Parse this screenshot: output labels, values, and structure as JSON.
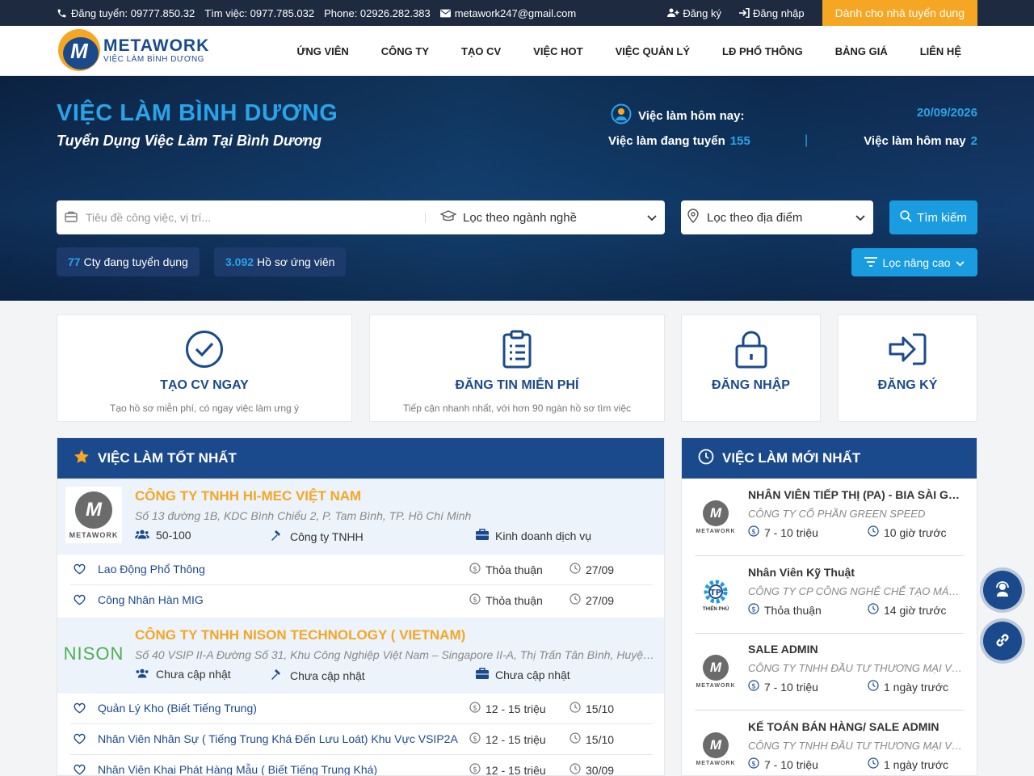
{
  "topbar": {
    "hotline_recruit": "Đăng tuyển: 09777.850.32",
    "hotline_job": "Tìm việc: 0977.785.032",
    "phone": "Phone: 02926.282.383",
    "email": "metawork247@gmail.com",
    "register": "Đăng ký",
    "login": "Đăng nhập",
    "employer": "Dành cho nhà tuyển dụng"
  },
  "logo": {
    "brand": "METAWORK",
    "sub": "VIỆC LÀM BÌNH DƯƠNG",
    "mark": "M"
  },
  "nav": [
    "ỨNG VIÊN",
    "CÔNG TY",
    "TẠO CV",
    "VIỆC HOT",
    "VIỆC QUẢN LÝ",
    "LĐ PHỔ THÔNG",
    "BẢNG GIÁ",
    "LIÊN HỆ"
  ],
  "hero": {
    "title": "VIỆC LÀM BÌNH DƯƠNG",
    "subtitle": "Tuyển Dụng Việc Làm Tại Bình Dương",
    "today_label": "Việc làm hôm nay:",
    "date": "20/09/2026",
    "open_label": "Việc làm đang tuyển",
    "open_count": "155",
    "sep": "|",
    "today_jobs_label": "Việc làm hôm nay",
    "today_jobs_count": "2"
  },
  "search": {
    "placeholder": "Tiêu đề công việc, vị trí...",
    "category": "Lọc theo ngành nghề",
    "location": "Lọc theo địa điểm",
    "button": "Tìm kiếm",
    "companies_count": "77",
    "companies_label": "Cty đang tuyển dụng",
    "cv_count": "3.092",
    "cv_label": "Hồ sơ ứng viên",
    "advanced": "Lọc nâng cao"
  },
  "features": [
    {
      "title": "TẠO CV NGAY",
      "desc": "Tạo hồ sơ miễn phí, có ngay việc làm ưng ý",
      "icon": "check-circle-icon"
    },
    {
      "title": "ĐĂNG TIN MIỄN PHÍ",
      "desc": "Tiếp cận nhanh nhất, với hơn 90 ngàn hồ sơ tìm việc",
      "icon": "clipboard-icon"
    },
    {
      "title": "ĐĂNG NHẬP",
      "desc": "",
      "icon": "lock-icon"
    },
    {
      "title": "ĐĂNG KÝ",
      "desc": "",
      "icon": "sign-in-icon"
    }
  ],
  "best": {
    "heading": "VIỆC LÀM TỐT NHẤT",
    "companies": [
      {
        "name": "CÔNG TY TNHH HI-MEC VIỆT NAM",
        "address": "Số 13 đường 1B, KDC Bình Chiểu 2, P. Tam Bình, TP. Hồ Chí Minh",
        "size": "50-100",
        "type": "Công ty TNHH",
        "field": "Kinh doanh dịch vụ",
        "logo_text": "METAWORK",
        "jobs": [
          {
            "title": "Lao Động Phổ Thông",
            "salary": "Thỏa thuận",
            "date": "27/09"
          },
          {
            "title": "Công Nhân Hàn MIG",
            "salary": "Thỏa thuận",
            "date": "27/09"
          }
        ]
      },
      {
        "name": "CÔNG TY TNHH NISON TECHNOLOGY ( VIETNAM)",
        "address": "Số 40 VSIP II-A Đường Số 31, Khu Công Nghiệp Việt Nam – Singapore II-A, Thị Trấn Tân Bình, Huyện Bắc Tân Uyên",
        "size": "Chưa cập nhật",
        "type": "Chưa cập nhật",
        "field": "Chưa cập nhật",
        "logo_text": "NISON",
        "jobs": [
          {
            "title": "Quản Lý Kho (Biết Tiếng Trung)",
            "salary": "12 - 15 triệu",
            "date": "15/10"
          },
          {
            "title": "Nhân Viên Nhân Sự ( Tiếng Trung Khá Đến Lưu Loát) Khu Vực VSIP2A",
            "salary": "12 - 15 triệu",
            "date": "15/10"
          },
          {
            "title": "Nhân Viên Khai Phát Hàng Mẫu ( Biết Tiếng Trung Khá)",
            "salary": "12 - 15 triệu",
            "date": "30/09"
          }
        ]
      }
    ]
  },
  "newest": {
    "heading": "VIỆC LÀM MỚI NHẤT",
    "items": [
      {
        "title": "NHÂN VIÊN TIẾP THỊ (PA) - BIA SÀI GÒN",
        "company": "CÔNG TY CỔ PHẦN GREEN SPEED",
        "salary": "7 - 10 triệu",
        "time": "10 giờ trước",
        "logo": "METAWORK"
      },
      {
        "title": "Nhân Viên Kỹ Thuật",
        "company": "CÔNG TY CP CÔNG NGHỆ CHẾ TẠO MÁY THIÊN PHÚ",
        "salary": "Thỏa thuận",
        "time": "14 giờ trước",
        "logo": "THIÊN PHÚ"
      },
      {
        "title": "SALE ADMIN",
        "company": "CÔNG TY TNHH ĐẦU TƯ THƯƠNG MẠI VÀ DỊCH VỤ",
        "salary": "7 - 10 triệu",
        "time": "1 ngày trước",
        "logo": "METAWORK"
      },
      {
        "title": "KẾ TOÁN BÁN HÀNG/ SALE ADMIN",
        "company": "CÔNG TY TNHH ĐẦU TƯ THƯƠNG MẠI VÀ DỊCH VỤ",
        "salary": "7 - 10 triệu",
        "time": "1 ngày trước",
        "logo": "METAWORK"
      }
    ]
  },
  "colors": {
    "primary": "#1b4a8c",
    "accent": "#f5a623",
    "link": "#1a9de0"
  }
}
